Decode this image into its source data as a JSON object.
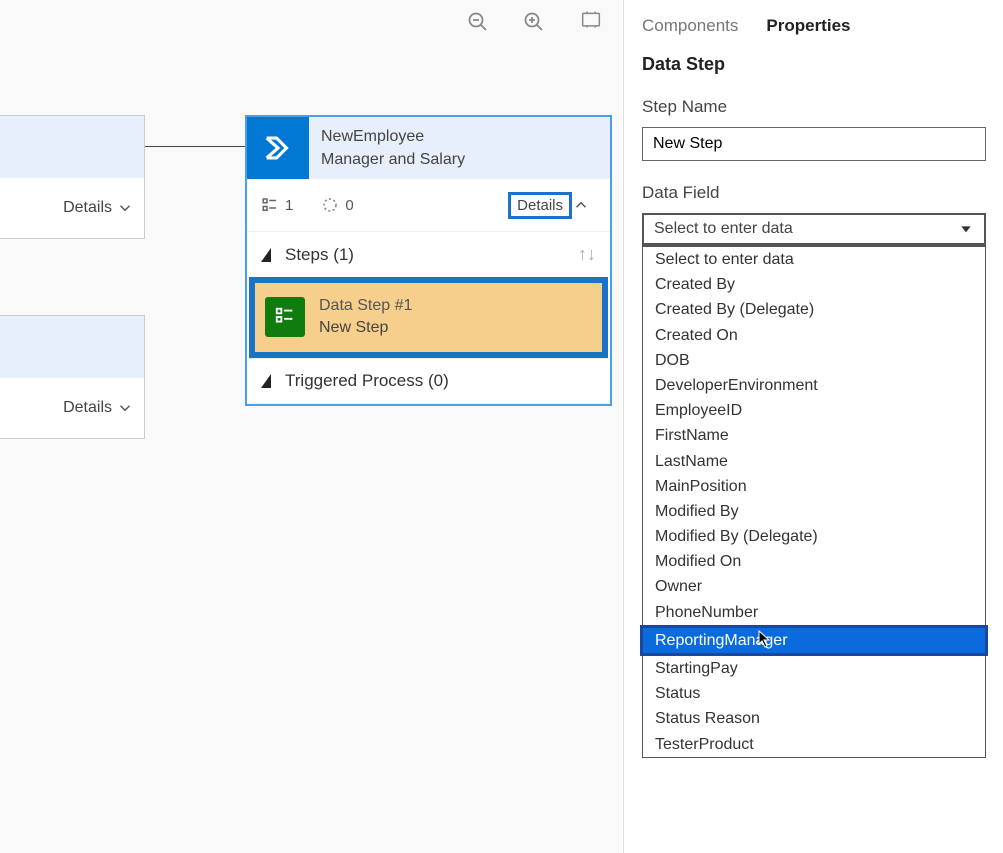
{
  "canvas": {
    "details_label": "Details",
    "stage": {
      "title_line1": "NewEmployee",
      "title_line2": "Manager and Salary",
      "count1": "1",
      "count2": "0",
      "details_label": "Details",
      "steps_header": "Steps (1)",
      "step": {
        "line1": "Data Step #1",
        "line2": "New Step"
      },
      "triggered_header": "Triggered Process (0)"
    }
  },
  "panel": {
    "tabs": {
      "components": "Components",
      "properties": "Properties"
    },
    "title": "Data Step",
    "step_name_label": "Step Name",
    "step_name_value": "New Step",
    "data_field_label": "Data Field",
    "data_field_selected": "Select to enter data",
    "options": [
      "Select to enter data",
      "Created By",
      "Created By (Delegate)",
      "Created On",
      "DOB",
      "DeveloperEnvironment",
      "EmployeeID",
      "FirstName",
      "LastName",
      "MainPosition",
      "Modified By",
      "Modified By (Delegate)",
      "Modified On",
      "Owner",
      "PhoneNumber",
      "ReportingManager",
      "StartingPay",
      "Status",
      "Status Reason",
      "TesterProduct"
    ],
    "highlighted_option": "ReportingManager"
  }
}
